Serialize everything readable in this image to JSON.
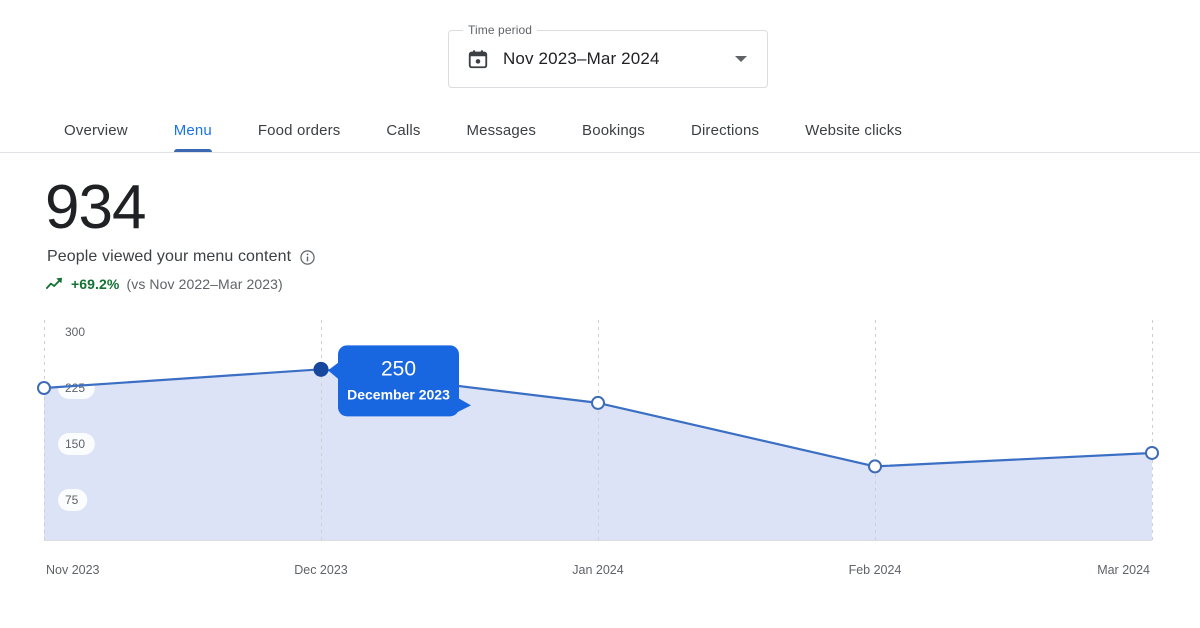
{
  "time_period": {
    "legend": "Time period",
    "value": "Nov 2023–Mar 2024",
    "calendar_icon": "calendar-icon",
    "caret_icon": "chevron-down-icon"
  },
  "tabs": {
    "active": "Menu",
    "items": [
      {
        "label": "Overview"
      },
      {
        "label": "Menu"
      },
      {
        "label": "Food orders"
      },
      {
        "label": "Calls"
      },
      {
        "label": "Messages"
      },
      {
        "label": "Bookings"
      },
      {
        "label": "Directions"
      },
      {
        "label": "Website clicks"
      }
    ]
  },
  "metric": {
    "value": "934",
    "label": "People viewed your menu content",
    "info_icon": "info-icon",
    "trend_icon": "trending-up-icon",
    "delta": "+69.2%",
    "delta_note": "(vs Nov 2022–Mar 2023)"
  },
  "colors": {
    "accent": "#1a73e8",
    "line": "#3b6fc4",
    "area_fill": "#dde3f7",
    "tooltip_bg": "#1967e0",
    "positive": "#137333",
    "text_primary": "#202124",
    "text_secondary": "#5f6368",
    "grid": "#d8d8d8"
  },
  "chart_data": {
    "type": "area",
    "title": "",
    "xlabel": "",
    "ylabel": "",
    "categories": [
      "Nov 2023",
      "Dec 2023",
      "Jan 2024",
      "Feb 2024",
      "Mar 2024"
    ],
    "values": [
      225,
      250,
      205,
      120,
      138
    ],
    "yticks": [
      300,
      225,
      150,
      75
    ],
    "ylim": [
      21,
      334
    ],
    "grid": true,
    "grid_style": "vertical-dashed",
    "legend": "none",
    "highlight": {
      "index": 1,
      "value": "250",
      "label": "December 2023"
    }
  }
}
